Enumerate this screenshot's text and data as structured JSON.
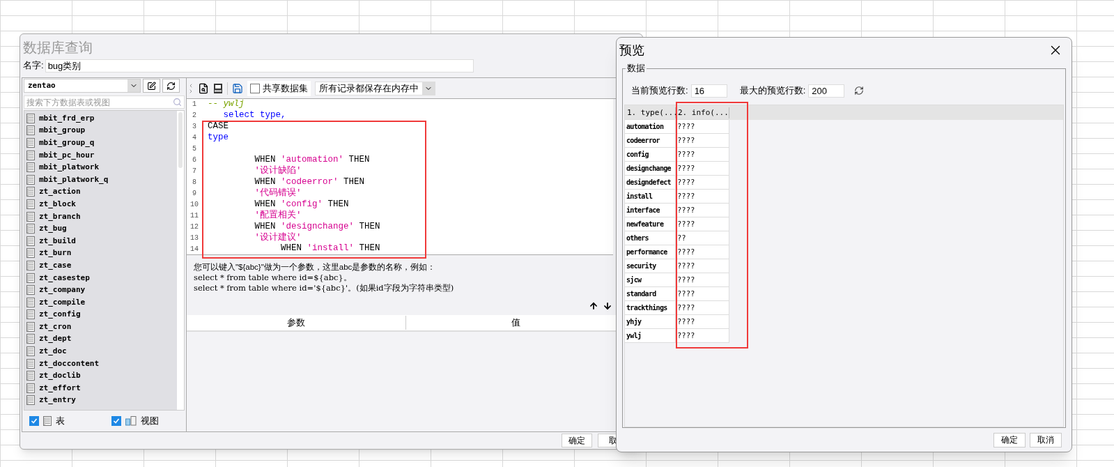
{
  "main_window": {
    "title": "数据库查询",
    "name_label": "名字:",
    "name_value": "bug类别",
    "connection": "zentao",
    "search": {
      "placeholder": "搜索下方数据表或视图"
    },
    "tables": [
      "mbit_frd_erp",
      "mbit_group",
      "mbit_group_q",
      "mbit_pc_hour",
      "mbit_platwork",
      "mbit_platwork_q",
      "zt_action",
      "zt_block",
      "zt_branch",
      "zt_bug",
      "zt_build",
      "zt_burn",
      "zt_case",
      "zt_casestep",
      "zt_company",
      "zt_compile",
      "zt_config",
      "zt_cron",
      "zt_dept",
      "zt_doc",
      "zt_doccontent",
      "zt_doclib",
      "zt_effort",
      "zt_entry"
    ],
    "filters": [
      {
        "kind": "table",
        "label": "表",
        "checked": true
      },
      {
        "kind": "view",
        "label": "视图",
        "checked": true
      }
    ],
    "share": {
      "label": "共享数据集",
      "checked": false
    },
    "storage": "所有记录都保存在内存中",
    "code_lines": [
      {
        "number": "1",
        "tokens": [
          {
            "kind": "comment",
            "text": "-- ywlj"
          }
        ]
      },
      {
        "number": "2",
        "tokens": [
          {
            "kind": "keyword",
            "text": "   select type,"
          }
        ]
      },
      {
        "number": "3",
        "tokens": [
          {
            "kind": "plain",
            "text": "CASE"
          }
        ]
      },
      {
        "number": "4",
        "tokens": [
          {
            "kind": "keyword",
            "text": "type"
          }
        ]
      },
      {
        "number": "5"
      },
      {
        "number": "6",
        "tokens": [
          {
            "kind": "plain",
            "text": "         WHEN "
          },
          {
            "kind": "string",
            "text": "'automation'"
          },
          {
            "kind": "plain",
            "text": " THEN"
          }
        ]
      },
      {
        "number": "7",
        "tokens": [
          {
            "kind": "string",
            "text": "         '设计缺陷'"
          }
        ]
      },
      {
        "number": "8",
        "tokens": [
          {
            "kind": "plain",
            "text": "         WHEN "
          },
          {
            "kind": "string",
            "text": "'codeerror'"
          },
          {
            "kind": "plain",
            "text": " THEN"
          }
        ]
      },
      {
        "number": "9",
        "tokens": [
          {
            "kind": "string",
            "text": "         '代码错误'"
          }
        ]
      },
      {
        "number": "10",
        "tokens": [
          {
            "kind": "plain",
            "text": "         WHEN "
          },
          {
            "kind": "string",
            "text": "'config'"
          },
          {
            "kind": "plain",
            "text": " THEN"
          }
        ]
      },
      {
        "number": "11",
        "tokens": [
          {
            "kind": "string",
            "text": "         '配置相关'"
          }
        ]
      },
      {
        "number": "12",
        "tokens": [
          {
            "kind": "plain",
            "text": "         WHEN "
          },
          {
            "kind": "string",
            "text": "'designchange'"
          },
          {
            "kind": "plain",
            "text": " THEN"
          }
        ]
      },
      {
        "number": "13",
        "tokens": [
          {
            "kind": "string",
            "text": "         '设计建议'"
          }
        ]
      },
      {
        "number": "14",
        "tokens": [
          {
            "kind": "plain",
            "text": "              WHEN "
          },
          {
            "kind": "string",
            "text": "'install'"
          },
          {
            "kind": "plain",
            "text": " THEN"
          }
        ]
      }
    ],
    "hint": [
      "您可以键入\"${abc}\"做为一个参数，这里abc是参数的名称，例如：",
      "select * from table where id=${abc}。",
      "select * from table where id='${abc}'。(如果id字段为字符串类型)"
    ],
    "param_columns": [
      "参数",
      "值"
    ],
    "buttons": [
      "确定",
      "取"
    ]
  },
  "preview_window": {
    "title": "预览",
    "group_label": "数据",
    "current_rows_label": "当前预览行数:",
    "current_rows": "16",
    "max_rows_label": "最大的预览行数:",
    "max_rows": "200",
    "columns": [
      "1. type(...",
      "2. info(..."
    ],
    "rows": [
      [
        "automation",
        "????"
      ],
      [
        "codeerror",
        "????"
      ],
      [
        "config",
        "????"
      ],
      [
        "designchange",
        "????"
      ],
      [
        "designdefect",
        "????"
      ],
      [
        "install",
        "????"
      ],
      [
        "interface",
        "????"
      ],
      [
        "newfeature",
        "????"
      ],
      [
        "others",
        "??"
      ],
      [
        "performance",
        "????"
      ],
      [
        "security",
        "????"
      ],
      [
        "sjcw",
        "????"
      ],
      [
        "standard",
        "????"
      ],
      [
        "trackthings",
        "????"
      ],
      [
        "yhjy",
        "????"
      ],
      [
        "ywlj",
        "????"
      ]
    ],
    "buttons": [
      "确定",
      "取消"
    ]
  }
}
